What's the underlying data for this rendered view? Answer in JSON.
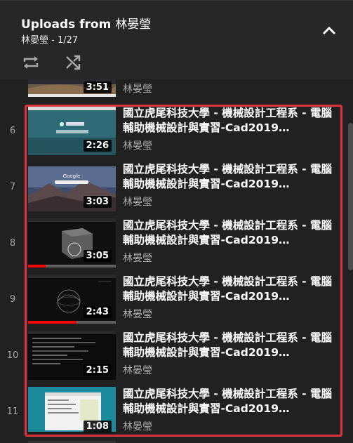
{
  "playlist": {
    "title_prefix": "Uploads from",
    "title_owner": "林晏瑩",
    "owner": "林晏瑩",
    "position": "1/27",
    "position_label": "林晏瑩 - 1/27"
  },
  "icons": {
    "collapse": "chevron-up-icon",
    "loop": "loop-icon",
    "shuffle": "shuffle-icon"
  },
  "colors": {
    "background": "#212121",
    "header": "#272727",
    "highlight_border": "#e0333b",
    "progress": "#ff0000"
  },
  "partial_item": {
    "duration": "3:51",
    "channel": "林晏瑩"
  },
  "items": [
    {
      "index": "6",
      "title": "國立虎尾科技大學 - 機械設計工程系 - 電腦輔助機械設計與實習-Cad2019…",
      "channel": "林晏瑩",
      "duration": "2:26",
      "watched": 0
    },
    {
      "index": "7",
      "title": "國立虎尾科技大學 - 機械設計工程系 - 電腦輔助機械設計與實習-Cad2019…",
      "channel": "林晏瑩",
      "duration": "3:03",
      "watched": 0
    },
    {
      "index": "8",
      "title": "國立虎尾科技大學 - 機械設計工程系 - 電腦輔助機械設計與實習-Cad2019…",
      "channel": "林晏瑩",
      "duration": "3:05",
      "watched": 0.2
    },
    {
      "index": "9",
      "title": "國立虎尾科技大學 - 機械設計工程系 - 電腦輔助機械設計與實習-Cad2019…",
      "channel": "林晏瑩",
      "duration": "2:43",
      "watched": 0.55
    },
    {
      "index": "10",
      "title": "國立虎尾科技大學 - 機械設計工程系 - 電腦輔助機械設計與實習-Cad2019…",
      "channel": "林晏瑩",
      "duration": "2:15",
      "watched": 0
    },
    {
      "index": "11",
      "title": "國立虎尾科技大學 - 機械設計工程系 - 電腦輔助機械設計與實習-Cad2019…",
      "channel": "林晏瑩",
      "duration": "1:08",
      "watched": 0
    }
  ]
}
